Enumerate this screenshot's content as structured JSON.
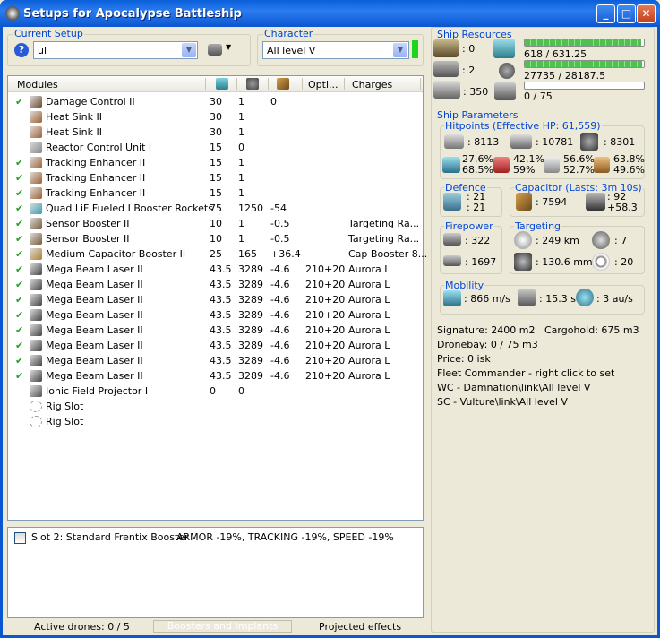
{
  "window": {
    "title": "Setups for Apocalypse Battleship"
  },
  "current_setup": {
    "label": "Current Setup",
    "value": "ul"
  },
  "character": {
    "label": "Character",
    "value": "All level V"
  },
  "modules": {
    "headers": [
      "Modules",
      "Opti...",
      "Charges"
    ],
    "rows": [
      {
        "on": "✔",
        "name": "Damage Control II",
        "c1": "30",
        "c2": "1",
        "c3": "0",
        "c4": "",
        "c5": ""
      },
      {
        "on": "",
        "name": "Heat Sink II",
        "c1": "30",
        "c2": "1",
        "c3": "",
        "c4": "",
        "c5": ""
      },
      {
        "on": "",
        "name": "Heat Sink II",
        "c1": "30",
        "c2": "1",
        "c3": "",
        "c4": "",
        "c5": ""
      },
      {
        "on": "",
        "name": "Reactor Control Unit I",
        "c1": "15",
        "c2": "0",
        "c3": "",
        "c4": "",
        "c5": ""
      },
      {
        "on": "✔",
        "name": "Tracking Enhancer II",
        "c1": "15",
        "c2": "1",
        "c3": "",
        "c4": "",
        "c5": ""
      },
      {
        "on": "✔",
        "name": "Tracking Enhancer II",
        "c1": "15",
        "c2": "1",
        "c3": "",
        "c4": "",
        "c5": ""
      },
      {
        "on": "✔",
        "name": "Tracking Enhancer II",
        "c1": "15",
        "c2": "1",
        "c3": "",
        "c4": "",
        "c5": ""
      },
      {
        "on": "✔",
        "name": "Quad LiF Fueled I Booster Rockets",
        "c1": "75",
        "c2": "1250",
        "c3": "-54",
        "c4": "",
        "c5": ""
      },
      {
        "on": "✔",
        "name": "Sensor Booster II",
        "c1": "10",
        "c2": "1",
        "c3": "-0.5",
        "c4": "",
        "c5": "Targeting Ra..."
      },
      {
        "on": "✔",
        "name": "Sensor Booster II",
        "c1": "10",
        "c2": "1",
        "c3": "-0.5",
        "c4": "",
        "c5": "Targeting Ra..."
      },
      {
        "on": "✔",
        "name": "Medium Capacitor Booster II",
        "c1": "25",
        "c2": "165",
        "c3": "+36.4",
        "c4": "",
        "c5": "Cap Booster 8..."
      },
      {
        "on": "✔",
        "name": "Mega Beam Laser II",
        "c1": "43.5",
        "c2": "3289",
        "c3": "-4.6",
        "c4": "210+20",
        "c5": "Aurora L"
      },
      {
        "on": "✔",
        "name": "Mega Beam Laser II",
        "c1": "43.5",
        "c2": "3289",
        "c3": "-4.6",
        "c4": "210+20",
        "c5": "Aurora L"
      },
      {
        "on": "✔",
        "name": "Mega Beam Laser II",
        "c1": "43.5",
        "c2": "3289",
        "c3": "-4.6",
        "c4": "210+20",
        "c5": "Aurora L"
      },
      {
        "on": "✔",
        "name": "Mega Beam Laser II",
        "c1": "43.5",
        "c2": "3289",
        "c3": "-4.6",
        "c4": "210+20",
        "c5": "Aurora L"
      },
      {
        "on": "✔",
        "name": "Mega Beam Laser II",
        "c1": "43.5",
        "c2": "3289",
        "c3": "-4.6",
        "c4": "210+20",
        "c5": "Aurora L"
      },
      {
        "on": "✔",
        "name": "Mega Beam Laser II",
        "c1": "43.5",
        "c2": "3289",
        "c3": "-4.6",
        "c4": "210+20",
        "c5": "Aurora L"
      },
      {
        "on": "✔",
        "name": "Mega Beam Laser II",
        "c1": "43.5",
        "c2": "3289",
        "c3": "-4.6",
        "c4": "210+20",
        "c5": "Aurora L"
      },
      {
        "on": "✔",
        "name": "Mega Beam Laser II",
        "c1": "43.5",
        "c2": "3289",
        "c3": "-4.6",
        "c4": "210+20",
        "c5": "Aurora L"
      },
      {
        "on": "",
        "name": "Ionic Field Projector I",
        "c1": "0",
        "c2": "0",
        "c3": "",
        "c4": "",
        "c5": ""
      },
      {
        "on": "",
        "name": "Rig Slot",
        "c1": "",
        "c2": "",
        "c3": "",
        "c4": "",
        "c5": ""
      },
      {
        "on": "",
        "name": "Rig Slot",
        "c1": "",
        "c2": "",
        "c3": "",
        "c4": "",
        "c5": ""
      }
    ]
  },
  "booster": {
    "slot": "Slot 2: Standard Frentix Booster",
    "effect": "ARMOR -19%, TRACKING -19%, SPEED -19%"
  },
  "statusbar": {
    "drones": "Active drones: 0 / 5",
    "boosters": "Boosters and Implants",
    "projected": "Projected effects"
  },
  "resources": {
    "title": "Ship Resources",
    "turrets": ": 0",
    "launchers": ": 2",
    "calibration": ": 350",
    "cpu": "618 / 631.25",
    "powergrid": "27735 / 28187.5",
    "drone_bw": "0 / 75",
    "cpu_pct": 0.979,
    "pg_pct": 0.984,
    "drone_pct": 0
  },
  "params": {
    "title": "Ship Parameters",
    "hitpoints": {
      "title": "Hitpoints (Effective HP: 61,559)",
      "shield": ": 8113",
      "armor": ": 10781",
      "structure": ": 8301",
      "res": [
        [
          "27.6%",
          "68.5%"
        ],
        [
          "42.1%",
          "59%"
        ],
        [
          "56.6%",
          "52.7%"
        ],
        [
          "63.8%",
          "49.6%"
        ]
      ]
    },
    "defence": {
      "title": "Defence",
      "a": ": 21",
      "b": ": 21"
    },
    "capacitor": {
      "title": "Capacitor (Lasts: 3m 10s)",
      "cap": ": 7594",
      "a": ": 92",
      "b": "+58.3"
    },
    "firepower": {
      "title": "Firepower",
      "a": ": 322",
      "b": ": 1697"
    },
    "targeting": {
      "title": "Targeting",
      "range": ": 249 km",
      "targets": ": 7",
      "res": ": 130.6 mm",
      "sig": ": 20"
    },
    "mobility": {
      "title": "Mobility",
      "speed": ": 866 m/s",
      "align": ": 15.3 s",
      "warp": ": 3 au/s"
    }
  },
  "misc": {
    "signature": "Signature: 2400 m2",
    "cargo": "Cargohold: 675 m3",
    "dronebay": "Dronebay: 0 / 75 m3",
    "price": "Price: 0 isk",
    "fleet": "Fleet Commander - right click to set",
    "wc": "WC - Damnation\\link\\All level V",
    "sc": "SC - Vulture\\link\\All level V"
  }
}
